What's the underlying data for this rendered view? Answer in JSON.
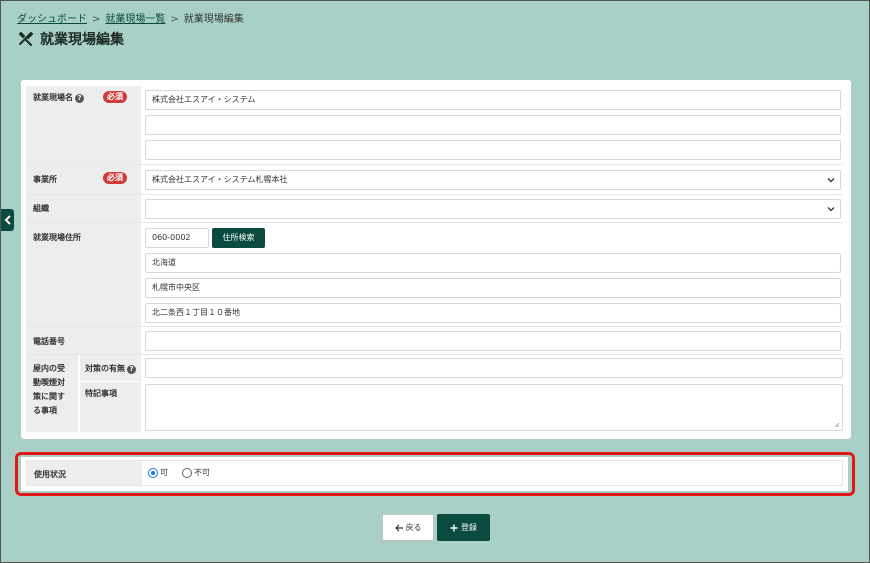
{
  "breadcrumb": {
    "items": [
      "ダッシュボード",
      "就業現場一覧",
      "就業現場編集"
    ]
  },
  "page": {
    "title": "就業現場編集"
  },
  "required_badge": "必須",
  "form": {
    "site_name": {
      "label": "就業現場名",
      "values": [
        "株式会社エスアイ・システム",
        "",
        ""
      ]
    },
    "office": {
      "label": "事業所",
      "value": "株式会社エスアイ・システム札幌本社"
    },
    "organization": {
      "label": "組織",
      "value": ""
    },
    "address": {
      "label": "就業現場住所",
      "postal_code": "060-0002",
      "search_button": "住所検索",
      "prefecture": "北海道",
      "city": "札幌市中央区",
      "street": "北二条西１丁目１０番地"
    },
    "phone": {
      "label": "電話番号",
      "value": ""
    },
    "smoking": {
      "label_lines": [
        "屋内の受",
        "動喫煙対",
        "策に関す",
        "る事項"
      ],
      "measures_label": "対策の有無",
      "measures_value": "",
      "notes_label": "特記事項",
      "notes_value": ""
    }
  },
  "usage": {
    "label": "使用状況",
    "options": [
      "可",
      "不可"
    ],
    "selected": "可"
  },
  "actions": {
    "back": "戻る",
    "register": "登録"
  },
  "colors": {
    "background": "#a8d0c6",
    "primary": "#0b4b3f",
    "required": "#d03a3a",
    "highlight": "#e01818"
  }
}
